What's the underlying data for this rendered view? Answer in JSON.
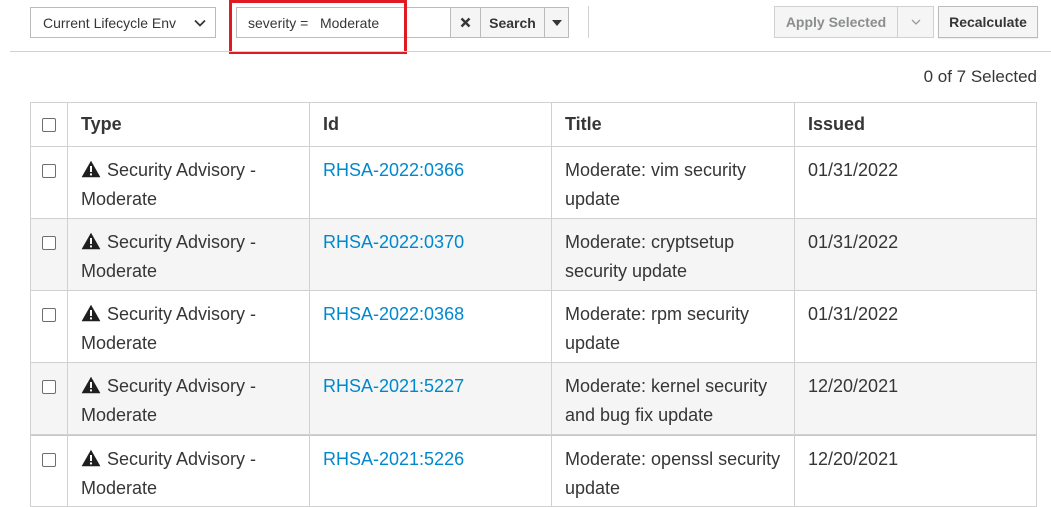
{
  "toolbar": {
    "env_select_value": "Current Lifecycle Env",
    "search_query": "severity =   Moderate",
    "search_label": "Search",
    "apply_label": "Apply Selected",
    "recalculate_label": "Recalculate"
  },
  "selection": {
    "count_text": "0 of 7 Selected"
  },
  "colors": {
    "highlight": "#e01a22",
    "link": "#0088ce",
    "row_alt": "#f5f5f5"
  },
  "table": {
    "columns": [
      "Type",
      "Id",
      "Title",
      "Issued"
    ],
    "rows": [
      {
        "type_line1": "Security Advisory -",
        "type_line2": "Moderate",
        "id": "RHSA-2022:0366",
        "title_line1": "Moderate: vim security",
        "title_line2": "update",
        "issued": "01/31/2022",
        "icon": "warning-icon"
      },
      {
        "type_line1": "Security Advisory -",
        "type_line2": "Moderate",
        "id": "RHSA-2022:0370",
        "title_line1": "Moderate: cryptsetup",
        "title_line2": "security update",
        "issued": "01/31/2022",
        "icon": "warning-icon"
      },
      {
        "type_line1": "Security Advisory -",
        "type_line2": "Moderate",
        "id": "RHSA-2022:0368",
        "title_line1": "Moderate: rpm security",
        "title_line2": "update",
        "issued": "01/31/2022",
        "icon": "warning-icon"
      },
      {
        "type_line1": "Security Advisory -",
        "type_line2": "Moderate",
        "id": "RHSA-2021:5227",
        "title_line1": "Moderate: kernel security",
        "title_line2": "and bug fix update",
        "issued": "12/20/2021",
        "icon": "warning-icon"
      },
      {
        "type_line1": "Security Advisory -",
        "type_line2": "Moderate",
        "id": "RHSA-2021:5226",
        "title_line1": "Moderate: openssl security",
        "title_line2": "update",
        "issued": "12/20/2021",
        "icon": "warning-icon"
      }
    ]
  }
}
